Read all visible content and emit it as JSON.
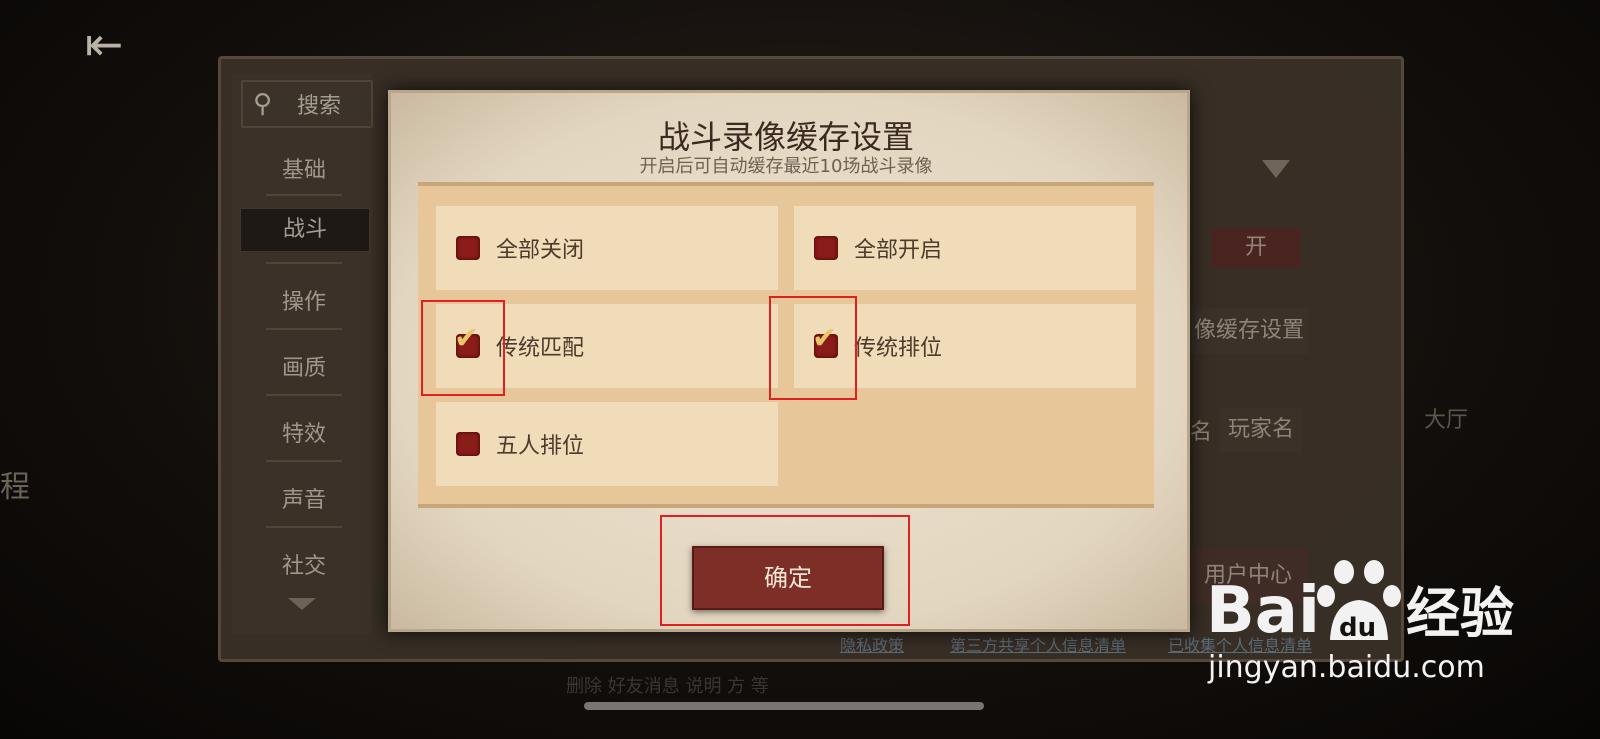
{
  "background": {
    "left_hint_char": "程",
    "search_label": "搜索",
    "nav_items": [
      "基础",
      "战斗",
      "操作",
      "画质",
      "特效",
      "声音",
      "社交"
    ],
    "active_nav": "战斗",
    "toggle_label": "开",
    "cache_settings_partial": "像缓存设置",
    "name_label_partial": "名",
    "player_name": "玩家名",
    "user_center": "用户中心",
    "right_side_partial": "大厅",
    "footer_links": [
      "隐私政策",
      "第三方共享个人信息清单",
      "已收集个人信息清单"
    ],
    "footer_note": "删除 好友消息 说明 方 等"
  },
  "modal": {
    "title": "战斗录像缓存设置",
    "subtitle": "开启后可自动缓存最近10场战斗录像",
    "options": [
      {
        "label": "全部关闭",
        "checked": false
      },
      {
        "label": "全部开启",
        "checked": false
      },
      {
        "label": "传统匹配",
        "checked": true
      },
      {
        "label": "传统排位",
        "checked": true
      },
      {
        "label": "五人排位",
        "checked": false
      }
    ],
    "confirm_label": "确定"
  },
  "watermark": {
    "brand": "Bai du 经验",
    "brand_a": "Bai",
    "brand_b": "du",
    "brand_c": "经验",
    "url": "jingyan.baidu.com"
  },
  "colors": {
    "accent_red": "#7c2e27",
    "highlight_red": "#e02020",
    "checkbox_red": "#8a1c1a"
  }
}
